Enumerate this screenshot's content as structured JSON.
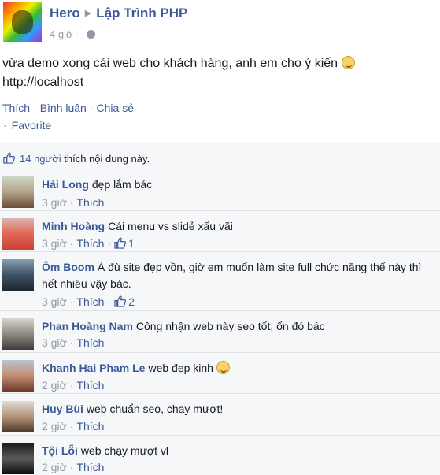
{
  "post": {
    "author": "Hero",
    "group": "Lập Trình PHP",
    "time": "4 giờ",
    "text_line1": "vừa demo xong cái web cho khách hàng, anh em cho ý kiến",
    "text_line2": "http://localhost",
    "actions": {
      "like": "Thích",
      "comment": "Bình luận",
      "share": "Chia sẻ",
      "favorite": "Favorite"
    }
  },
  "likes": {
    "count_text": "14 người",
    "suffix": " thích nội dung này."
  },
  "comments": [
    {
      "name": "Hải Long",
      "text": "đẹp lắm bác",
      "time": "3 giờ",
      "like": "Thích",
      "likes": ""
    },
    {
      "name": "Minh Hoàng",
      "text": "Cái menu vs slidẻ xấu vãi",
      "time": "3 giờ",
      "like": "Thích",
      "likes": "1"
    },
    {
      "name": "Ôm Boom",
      "text": "Á đù site đẹp vồn, giờ em muốn làm site full chức năng thế này thì hết nhiêu vậy bác.",
      "time": "3 giờ",
      "like": "Thích",
      "likes": "2"
    },
    {
      "name": "Phan Hoàng Nam",
      "text": "Công nhận web này seo tốt, ổn đó bác",
      "time": "3 giờ",
      "like": "Thích",
      "likes": ""
    },
    {
      "name": "Khanh Hai Pham Le",
      "text": "web đẹp kinh",
      "time": "2 giờ",
      "like": "Thích",
      "likes": ""
    },
    {
      "name": "Huy Bùi",
      "text": "web chuẩn seo, chạy mượt!",
      "time": "2 giờ",
      "like": "Thích",
      "likes": ""
    },
    {
      "name": "Tội Lỗi",
      "text": "web chạy mượt vl",
      "time": "2 giờ",
      "like": "Thích",
      "likes": ""
    }
  ],
  "colors": {
    "link": "#3b5998",
    "muted": "#9197a3",
    "ufi_bg": "#f6f7f9"
  }
}
